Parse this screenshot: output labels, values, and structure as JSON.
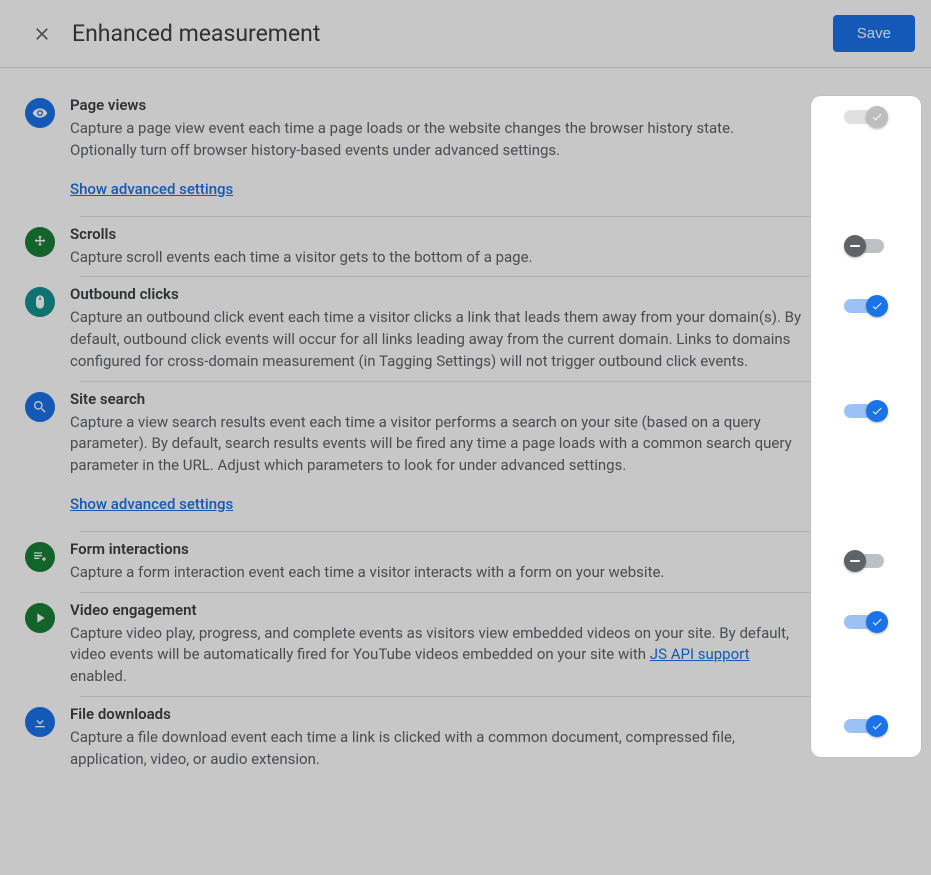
{
  "header": {
    "title": "Enhanced measurement",
    "save_label": "Save"
  },
  "links": {
    "show_advanced": "Show advanced settings",
    "js_api_support": "JS API support"
  },
  "items": [
    {
      "id": "page-views",
      "title": "Page views",
      "desc": "Capture a page view event each time a page loads or the website changes the browser history state. Optionally turn off browser history-based events under advanced settings.",
      "icon": "eye",
      "icon_color": "blue",
      "toggle": "locked",
      "advanced": true
    },
    {
      "id": "scrolls",
      "title": "Scrolls",
      "desc": "Capture scroll events each time a visitor gets to the bottom of a page.",
      "icon": "target",
      "icon_color": "green",
      "toggle": "off",
      "advanced": false
    },
    {
      "id": "outbound-clicks",
      "title": "Outbound clicks",
      "desc": "Capture an outbound click event each time a visitor clicks a link that leads them away from your domain(s). By default, outbound click events will occur for all links leading away from the current domain. Links to domains configured for cross-domain measurement (in Tagging Settings) will not trigger outbound click events.",
      "icon": "mouse",
      "icon_color": "teal",
      "toggle": "on",
      "advanced": false
    },
    {
      "id": "site-search",
      "title": "Site search",
      "desc": "Capture a view search results event each time a visitor performs a search on your site (based on a query parameter). By default, search results events will be fired any time a page loads with a common search query parameter in the URL. Adjust which parameters to look for under advanced settings.",
      "icon": "search",
      "icon_color": "blue",
      "toggle": "on",
      "advanced": true
    },
    {
      "id": "form-interactions",
      "title": "Form interactions",
      "desc": "Capture a form interaction event each time a visitor interacts with a form on your website.",
      "icon": "form",
      "icon_color": "green",
      "toggle": "off",
      "advanced": false
    },
    {
      "id": "video-engagement",
      "title": "Video engagement",
      "desc_pre": "Capture video play, progress, and complete events as visitors view embedded videos on your site. By default, video events will be automatically fired for YouTube videos embedded on your site with ",
      "desc_post": " enabled.",
      "icon": "play",
      "icon_color": "green",
      "toggle": "on",
      "advanced": false,
      "has_link": true
    },
    {
      "id": "file-downloads",
      "title": "File downloads",
      "desc": "Capture a file download event each time a link is clicked with a common document, compressed file, application, video, or audio extension.",
      "icon": "download",
      "icon_color": "blue",
      "toggle": "on",
      "advanced": false
    }
  ]
}
